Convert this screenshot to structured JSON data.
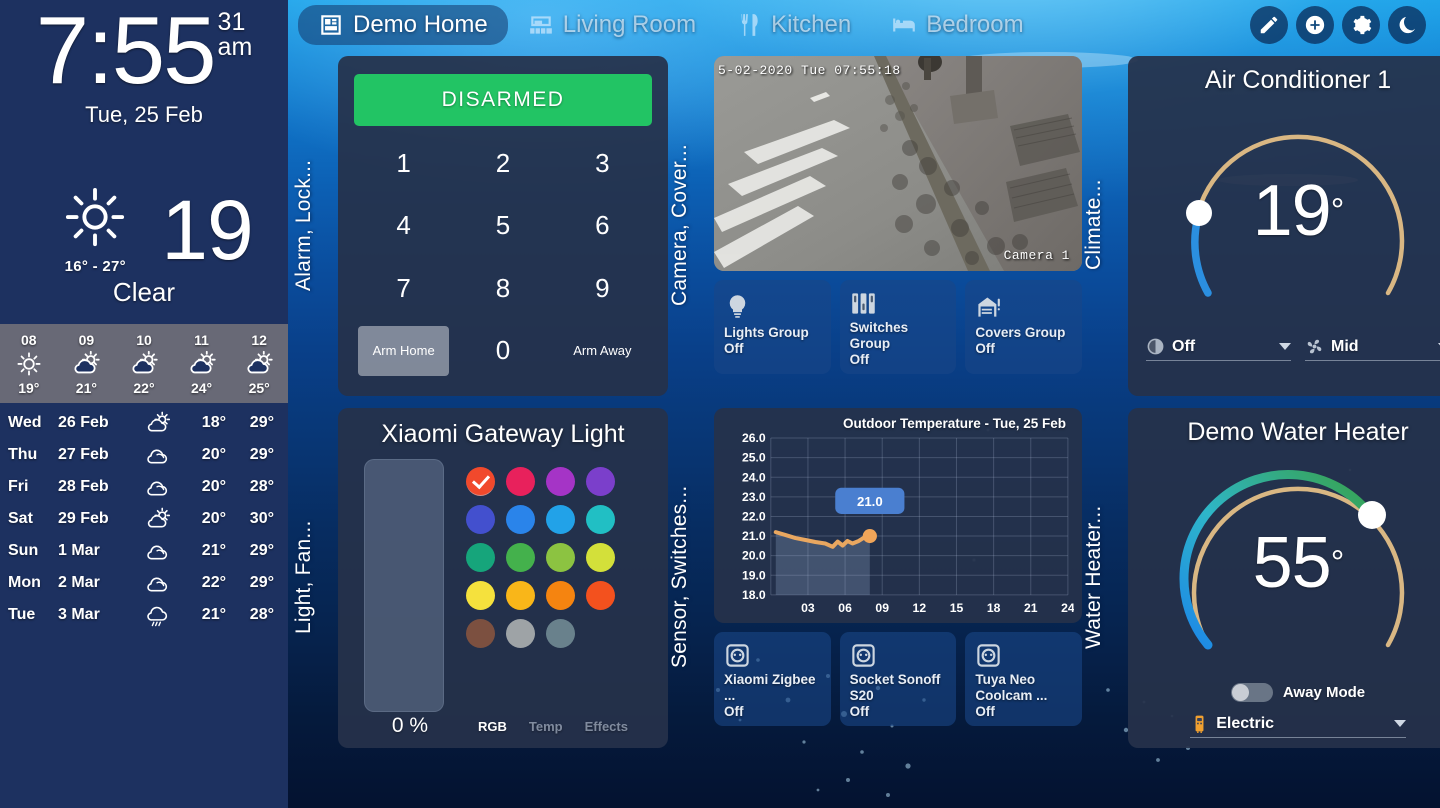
{
  "sidebar": {
    "clock": {
      "time": "7:55",
      "seconds": "31",
      "ampm": "am",
      "date": "Tue, 25 Feb"
    },
    "current_weather": {
      "temperature": "19",
      "range": "16° - 27°",
      "condition": "Clear",
      "icon": "sunny-icon"
    },
    "hourly": [
      {
        "hour": "08",
        "temp": "19°",
        "icon": "sunny-icon"
      },
      {
        "hour": "09",
        "temp": "21°",
        "icon": "partly-cloudy-icon"
      },
      {
        "hour": "10",
        "temp": "22°",
        "icon": "partly-cloudy-icon"
      },
      {
        "hour": "11",
        "temp": "24°",
        "icon": "partly-cloudy-icon"
      },
      {
        "hour": "12",
        "temp": "25°",
        "icon": "partly-cloudy-icon"
      }
    ],
    "daily": [
      {
        "day": "Wed",
        "date": "26 Feb",
        "icon": "partly-cloudy-icon",
        "low": "18°",
        "high": "29°"
      },
      {
        "day": "Thu",
        "date": "27 Feb",
        "icon": "cloudy-icon",
        "low": "20°",
        "high": "29°"
      },
      {
        "day": "Fri",
        "date": "28 Feb",
        "icon": "cloudy-icon",
        "low": "20°",
        "high": "28°"
      },
      {
        "day": "Sat",
        "date": "29 Feb",
        "icon": "partly-cloudy-icon",
        "low": "20°",
        "high": "30°"
      },
      {
        "day": "Sun",
        "date": "1 Mar",
        "icon": "cloudy-icon",
        "low": "21°",
        "high": "29°"
      },
      {
        "day": "Mon",
        "date": "2 Mar",
        "icon": "cloudy-icon",
        "low": "22°",
        "high": "29°"
      },
      {
        "day": "Tue",
        "date": "3 Mar",
        "icon": "rainy-icon",
        "low": "21°",
        "high": "28°"
      }
    ]
  },
  "topbar": {
    "tabs": [
      {
        "label": "Demo Home",
        "icon": "view-dashboard-icon",
        "active": true
      },
      {
        "label": "Living Room",
        "icon": "sofa-icon",
        "active": false
      },
      {
        "label": "Kitchen",
        "icon": "silverware-icon",
        "active": false
      },
      {
        "label": "Bedroom",
        "icon": "bed-icon",
        "active": false
      }
    ],
    "actions": [
      {
        "name": "edit-dashboard-button",
        "icon": "pencil-icon"
      },
      {
        "name": "add-card-button",
        "icon": "plus-circle-icon"
      },
      {
        "name": "settings-button",
        "icon": "gear-icon"
      },
      {
        "name": "dark-mode-button",
        "icon": "moon-icon"
      }
    ]
  },
  "sections": {
    "alarm_lock": "Alarm, Lock...",
    "camera_cover": "Camera, Cover...",
    "climate": "Climate...",
    "light_fan": "Light, Fan...",
    "sensor_switches": "Sensor, Switches...",
    "water_heater": "Water Heater..."
  },
  "alarm": {
    "state": "DISARMED",
    "state_color": "#22c464",
    "keys": [
      "1",
      "2",
      "3",
      "4",
      "5",
      "6",
      "7",
      "8",
      "9"
    ],
    "arm_home": "Arm Home",
    "zero": "0",
    "arm_away": "Arm Away"
  },
  "camera": {
    "timestamp": "5-02-2020 Tue 07:55:18",
    "name": "Camera 1"
  },
  "group_tiles": [
    {
      "name": "Lights Group",
      "state": "Off",
      "icon": "lightbulb-icon"
    },
    {
      "name": "Switches Group",
      "state": "Off",
      "icon": "toggle-switches-icon"
    },
    {
      "name": "Covers Group",
      "state": "Off",
      "icon": "garage-alert-icon"
    }
  ],
  "socket_tiles": [
    {
      "name": "Xiaomi Zigbee ...",
      "state": "Off",
      "icon": "power-socket-icon"
    },
    {
      "name": "Socket Sonoff S20",
      "state": "Off",
      "icon": "power-socket-icon"
    },
    {
      "name": "Tuya Neo Coolcam ...",
      "state": "Off",
      "icon": "power-socket-icon"
    }
  ],
  "air_conditioner": {
    "title": "Air Conditioner 1",
    "temperature": "19",
    "degree": "°",
    "mode": "Off",
    "mode_icon": "hvac-off-icon",
    "fan": "Mid",
    "fan_icon": "fan-icon",
    "track_color": "#d9b783",
    "active_color": "#2b8fe0",
    "min": 7,
    "max": 35,
    "value": 19
  },
  "water_heater": {
    "title": "Demo Water Heater",
    "temperature": "55",
    "degree": "°",
    "away_mode_label": "Away Mode",
    "away_mode_on": false,
    "operation": "Electric",
    "operation_icon": "water-heater-icon",
    "track_color": "#d9b783",
    "gradient_from": "#1c86e8",
    "gradient_to": "#38a14a",
    "min": 30,
    "max": 70,
    "value": 55
  },
  "light": {
    "title": "Xiaomi Gateway Light",
    "brightness": "0 %",
    "brightness_pct": 0,
    "modes": [
      {
        "label": "RGB",
        "active": true
      },
      {
        "label": "Temp",
        "active": false
      },
      {
        "label": "Effects",
        "active": false
      }
    ],
    "swatches": [
      {
        "color": "#f1492c",
        "selected": true
      },
      {
        "color": "#e8215c",
        "selected": false
      },
      {
        "color": "#a534c6",
        "selected": false
      },
      {
        "color": "#7b3fcb",
        "selected": false
      },
      {
        "color": "#4350ce",
        "selected": false
      },
      {
        "color": "#2a84ea",
        "selected": false
      },
      {
        "color": "#22a2e8",
        "selected": false
      },
      {
        "color": "#21bfc4",
        "selected": false
      },
      {
        "color": "#16a57b",
        "selected": false
      },
      {
        "color": "#44b14c",
        "selected": false
      },
      {
        "color": "#8cc341",
        "selected": false
      },
      {
        "color": "#d3e03a",
        "selected": false
      },
      {
        "color": "#f5e13d",
        "selected": false
      },
      {
        "color": "#f9b619",
        "selected": false
      },
      {
        "color": "#f58410",
        "selected": false
      },
      {
        "color": "#f3511e",
        "selected": false
      },
      {
        "color": "#7c5040",
        "selected": false
      },
      {
        "color": "#9ea3a6",
        "selected": false
      },
      {
        "color": "#69818c",
        "selected": false
      }
    ]
  },
  "chart_data": {
    "type": "line",
    "title": "Outdoor Temperature - Tue, 25 Feb",
    "xlabel": "",
    "ylabel": "",
    "ylim": [
      18.0,
      26.0
    ],
    "yticks": [
      "18.0",
      "19.0",
      "20.0",
      "21.0",
      "22.0",
      "23.0",
      "24.0",
      "25.0",
      "26.0"
    ],
    "xlim": [
      0,
      24
    ],
    "xticks": [
      "03",
      "06",
      "09",
      "12",
      "15",
      "18",
      "21",
      "24"
    ],
    "grid": true,
    "legend": "none",
    "line_color": "#e9a760",
    "fill_color": "rgba(160,180,215,0.26)",
    "annotation": {
      "label": "21.0",
      "x": 8,
      "y": 21.0
    },
    "series": [
      {
        "name": "Outdoor Temperature",
        "x": [
          0.4,
          1.2,
          2.0,
          2.8,
          3.6,
          4.4,
          5.0,
          5.4,
          5.8,
          6.2,
          6.6,
          7.1,
          7.6,
          8.0
        ],
        "y": [
          21.2,
          21.05,
          20.9,
          20.8,
          20.7,
          20.62,
          20.45,
          20.72,
          20.52,
          20.75,
          20.62,
          20.75,
          20.95,
          21.0
        ]
      }
    ]
  }
}
